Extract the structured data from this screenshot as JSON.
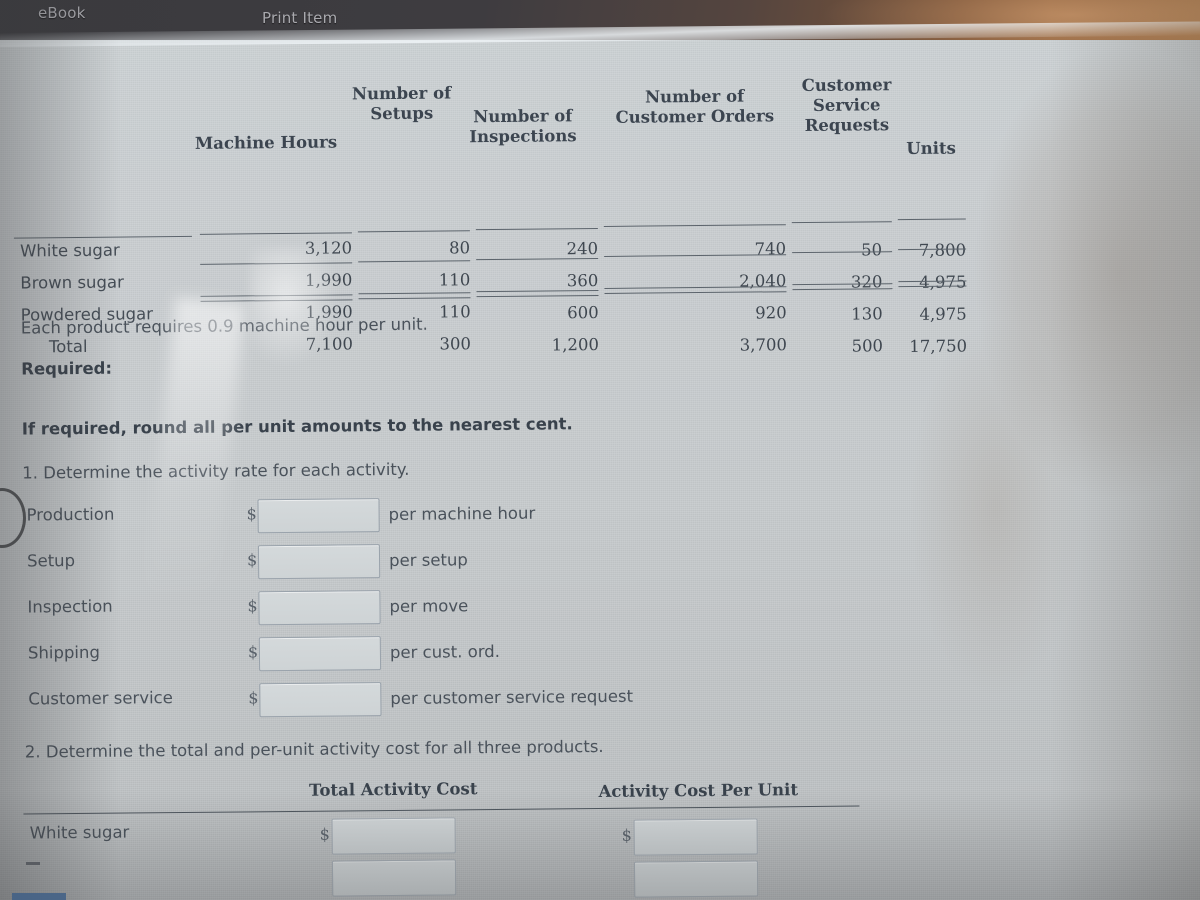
{
  "app": {
    "topbar": {
      "ebook_label": "eBook",
      "print_label": "Print Item"
    }
  },
  "table": {
    "headers": {
      "machine_hours": "Machine Hours",
      "setups": "Number of\nSetups",
      "setups_l1": "Number of",
      "setups_l2": "Setups",
      "inspections_l1": "Number of",
      "inspections_l2": "Inspections",
      "customer_orders_l1": "Number of",
      "customer_orders_l2": "Customer Orders",
      "service_requests_l1": "Customer",
      "service_requests_l2": "Service",
      "service_requests_l3": "Requests",
      "units": "Units"
    },
    "rows": [
      {
        "name": "White sugar",
        "machine_hours": "3,120",
        "setups": "80",
        "inspections": "240",
        "customer_orders": "740",
        "service_requests": "50",
        "units": "7,800"
      },
      {
        "name": "Brown sugar",
        "machine_hours": "1,990",
        "setups": "110",
        "inspections": "360",
        "customer_orders": "2,040",
        "service_requests": "320",
        "units": "4,975"
      },
      {
        "name": "Powdered sugar",
        "machine_hours": "1,990",
        "setups": "110",
        "inspections": "600",
        "customer_orders": "920",
        "service_requests": "130",
        "units": "4,975"
      }
    ],
    "total": {
      "name": "Total",
      "machine_hours": "7,100",
      "setups": "300",
      "inspections": "1,200",
      "customer_orders": "3,700",
      "service_requests": "500",
      "units": "17,750"
    }
  },
  "prose": {
    "each_product": "Each product requires 0.9 machine hour per unit.",
    "required": "Required:",
    "rounding": "If required, round all per unit amounts to the nearest cent.",
    "question1": "1.  Determine the activity rate for each activity.",
    "question2": "2.  Determine the total and per-unit activity cost for all three products."
  },
  "activity_rates": {
    "currency_symbol": "$",
    "rows": [
      {
        "label": "Production",
        "value": "",
        "suffix": "per machine hour"
      },
      {
        "label": "Setup",
        "value": "",
        "suffix": "per setup"
      },
      {
        "label": "Inspection",
        "value": "",
        "suffix": "per move"
      },
      {
        "label": "Shipping",
        "value": "",
        "suffix": "per cust. ord."
      },
      {
        "label": "Customer service",
        "value": "",
        "suffix": "per customer service request"
      }
    ]
  },
  "cost_table": {
    "currency_symbol": "$",
    "headers": {
      "total_activity_cost": "Total Activity Cost",
      "activity_cost_per_unit": "Activity Cost Per Unit"
    },
    "rows": [
      {
        "label": "White sugar",
        "total_cost": "",
        "cost_per_unit": ""
      },
      {
        "label": "",
        "total_cost": "",
        "cost_per_unit": ""
      }
    ]
  },
  "colors": {
    "page_background": "#c8cccf",
    "topbar_dark": "#3a3a3e",
    "topbar_warm": "#b07c4c",
    "text_primary": "#3f4750",
    "rule": "#5c646c",
    "input_border": "#9aa3ac"
  }
}
